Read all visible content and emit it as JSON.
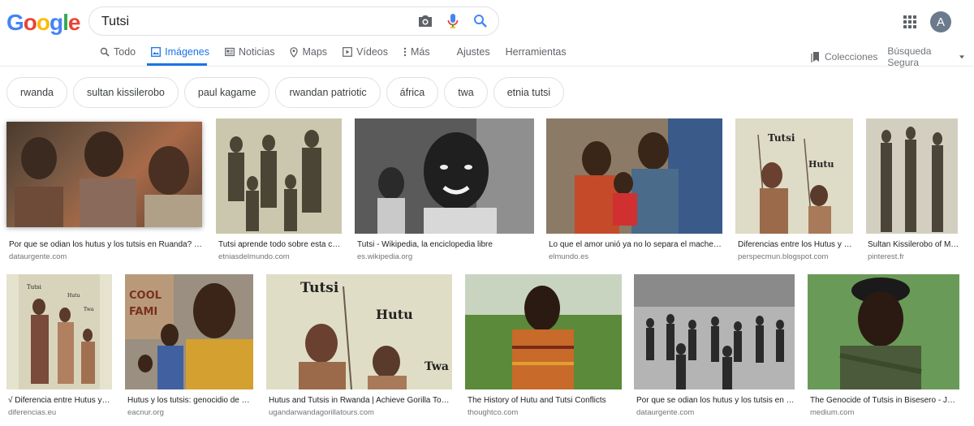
{
  "logo": {
    "letters": [
      "G",
      "o",
      "o",
      "g",
      "l",
      "e"
    ],
    "colors": [
      "#4285f4",
      "#ea4335",
      "#fbbc05",
      "#4285f4",
      "#34a853",
      "#ea4335"
    ]
  },
  "search": {
    "query": "Tutsi"
  },
  "account": {
    "initial": "A"
  },
  "tabs": [
    {
      "label": "Todo",
      "icon": "search-icon"
    },
    {
      "label": "Imágenes",
      "icon": "image-icon",
      "active": true
    },
    {
      "label": "Noticias",
      "icon": "news-icon"
    },
    {
      "label": "Maps",
      "icon": "map-pin-icon"
    },
    {
      "label": "Vídeos",
      "icon": "video-icon"
    },
    {
      "label": "Más",
      "icon": "more-vert-icon"
    }
  ],
  "tools": {
    "settings": "Ajustes",
    "tools": "Herramientas",
    "collections": "Colecciones",
    "safesearch": "Búsqueda Segura"
  },
  "chips": [
    "rwanda",
    "sultan kissilerobo",
    "paul kagame",
    "rwandan patriotic",
    "áfrica",
    "twa",
    "etnia tutsi"
  ],
  "results": [
    {
      "caption": "Por que se odian los hutus y los tutsis en Ruanda? –…",
      "source": "dataurgente.com"
    },
    {
      "caption": "Tutsi aprende todo sobre esta c…",
      "source": "etniasdelmundo.com"
    },
    {
      "caption": "Tutsi - Wikipedia, la enciclopedia libre",
      "source": "es.wikipedia.org"
    },
    {
      "caption": "Lo que el amor unió ya no lo separa el machet…",
      "source": "elmundo.es"
    },
    {
      "caption": "Diferencias entre los Hutus y l…",
      "source": "perspecmun.blogspot.com"
    },
    {
      "caption": "Sultan Kissilerobo of M…",
      "source": "pinterest.fr"
    },
    {
      "caption": "√ Diferencia entre Hutus y …",
      "source": "diferencias.eu"
    },
    {
      "caption": "Hutus y los tutsis: genocidio de …",
      "source": "eacnur.org"
    },
    {
      "caption": "Hutus and Tutsis in Rwanda | Achieve Gorilla Tours",
      "source": "ugandarwandagorillatours.com"
    },
    {
      "caption": "The History of Hutu and Tutsi Conflicts",
      "source": "thoughtco.com"
    },
    {
      "caption": "Por que se odian los hutus y los tutsis en …",
      "source": "dataurgente.com"
    },
    {
      "caption": "The Genocide of Tutsis in Bisesero - Ju…",
      "source": "medium.com"
    }
  ],
  "image_texts": {
    "tutsi": "Tutsi",
    "hutu": "Hutu",
    "twa": "Twa",
    "cool": "COOL",
    "fami": "FAMI"
  }
}
